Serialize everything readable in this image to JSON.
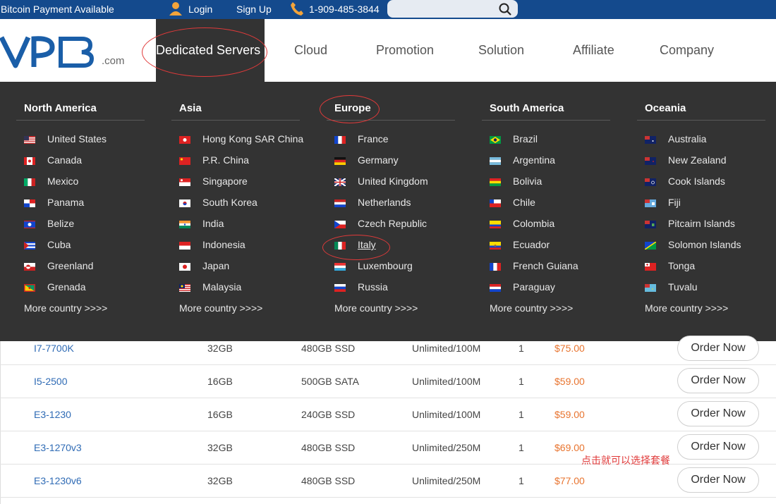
{
  "topbar": {
    "notice": "Bitcoin Payment Available",
    "login": "Login",
    "signup": "Sign Up",
    "phone": "1-909-485-3844",
    "search_icon": "search-icon"
  },
  "header": {
    "logo_text": "VPB",
    "logo_suffix": ".com",
    "nav": [
      "Dedicated Servers",
      "Cloud",
      "Promotion",
      "Solution",
      "Affiliate",
      "Company"
    ]
  },
  "menu": {
    "columns": [
      {
        "title": "North America",
        "items": [
          "United States",
          "Canada",
          "Mexico",
          "Panama",
          "Belize",
          "Cuba",
          "Greenland",
          "Grenada"
        ],
        "more": "More country >>>>"
      },
      {
        "title": "Asia",
        "items": [
          "Hong Kong SAR China",
          "P.R. China",
          "Singapore",
          "South Korea",
          "India",
          "Indonesia",
          "Japan",
          "Malaysia"
        ],
        "more": "More country >>>>"
      },
      {
        "title": "Europe",
        "items": [
          "France",
          "Germany",
          "United Kingdom",
          "Netherlands",
          "Czech Republic",
          "Italy",
          "Luxembourg",
          "Russia"
        ],
        "more": "More country >>>>"
      },
      {
        "title": "South America",
        "items": [
          "Brazil",
          "Argentina",
          "Bolivia",
          "Chile",
          "Colombia",
          "Ecuador",
          "French Guiana",
          "Paraguay"
        ],
        "more": "More country >>>>"
      },
      {
        "title": "Oceania",
        "items": [
          "Australia",
          "New Zealand",
          "Cook Islands",
          "Fiji",
          "Pitcairn Islands",
          "Solomon Islands",
          "Tonga",
          "Tuvalu"
        ],
        "more": "More country >>>>"
      }
    ]
  },
  "table": {
    "rows": [
      {
        "cpu": "I7-7700K",
        "ram": "32GB",
        "disk": "480GB SSD",
        "bw": "Unlimited/100M",
        "ip": "1",
        "price": "$75.00",
        "action": "Order Now"
      },
      {
        "cpu": "I5-2500",
        "ram": "16GB",
        "disk": "500GB SATA",
        "bw": "Unlimited/100M",
        "ip": "1",
        "price": "$59.00",
        "action": "Order Now"
      },
      {
        "cpu": "E3-1230",
        "ram": "16GB",
        "disk": "240GB SSD",
        "bw": "Unlimited/100M",
        "ip": "1",
        "price": "$59.00",
        "action": "Order Now"
      },
      {
        "cpu": "E3-1270v3",
        "ram": "32GB",
        "disk": "480GB SSD",
        "bw": "Unlimited/250M",
        "ip": "1",
        "price": "$69.00",
        "action": "Order Now"
      },
      {
        "cpu": "E3-1230v6",
        "ram": "32GB",
        "disk": "480GB SSD",
        "bw": "Unlimited/250M",
        "ip": "1",
        "price": "$77.00",
        "action": "Order Now"
      }
    ]
  },
  "annotation": "点击就可以选择套餐",
  "colors": {
    "topbar": "#144a8d",
    "menu_bg": "#333333",
    "price": "#e8742f",
    "link": "#2f6bb5",
    "annotation": "#e03a3a"
  }
}
